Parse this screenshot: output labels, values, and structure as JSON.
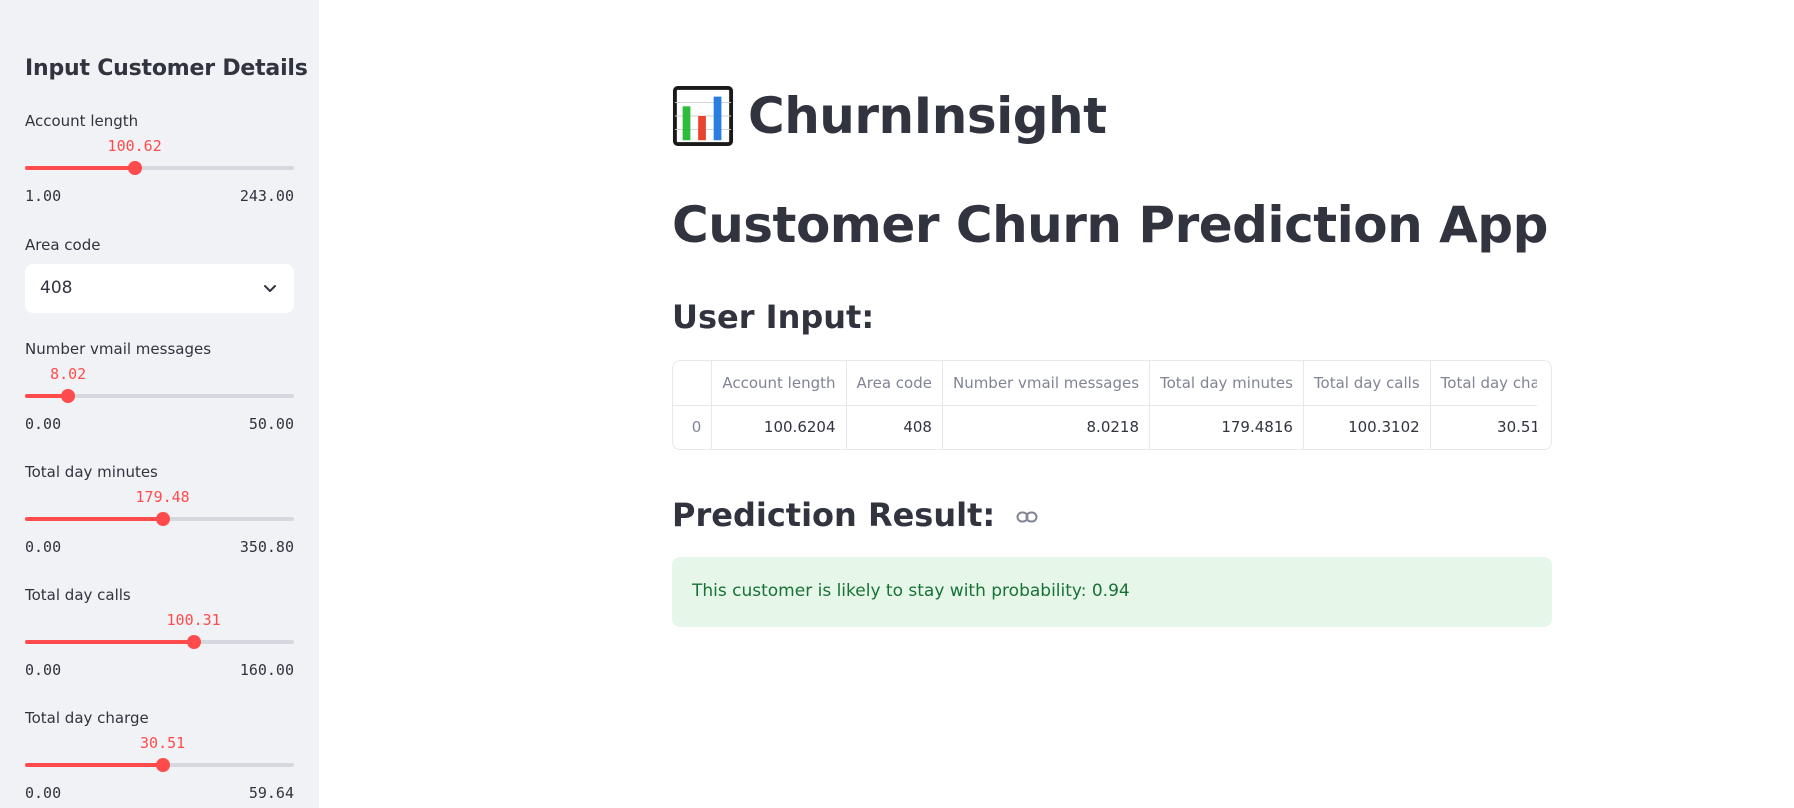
{
  "sidebar": {
    "title": "Input Customer Details",
    "sliders": [
      {
        "label": "Account length",
        "value": "100.62",
        "min": "1.00",
        "max": "243.00",
        "fraction": 0.4076
      },
      {
        "label": "Number vmail messages",
        "value": "8.02",
        "min": "0.00",
        "max": "50.00",
        "fraction": 0.1604
      },
      {
        "label": "Total day minutes",
        "value": "179.48",
        "min": "0.00",
        "max": "350.80",
        "fraction": 0.5116
      },
      {
        "label": "Total day calls",
        "value": "100.31",
        "min": "0.00",
        "max": "160.00",
        "fraction": 0.6269
      },
      {
        "label": "Total day charge",
        "value": "30.51",
        "min": "0.00",
        "max": "59.64",
        "fraction": 0.5116
      }
    ],
    "area_code": {
      "label": "Area code",
      "value": "408"
    }
  },
  "main": {
    "brand_title": "ChurnInsight",
    "brand_icon": "bar-chart-icon",
    "app_title": "Customer Churn Prediction App",
    "user_input_heading": "User Input:",
    "table": {
      "columns": [
        "",
        "Account length",
        "Area code",
        "Number vmail messages",
        "Total day minutes",
        "Total day calls",
        "Total day cha"
      ],
      "rows": [
        [
          "0",
          "100.6204",
          "408",
          "8.0218",
          "179.4816",
          "100.3102",
          "30.51"
        ]
      ]
    },
    "prediction_heading": "Prediction Result:",
    "prediction_text": "This customer is likely to stay with probability: 0.94"
  },
  "colors": {
    "accent": "#ff4b4b",
    "sidebar_bg": "#f0f2f6",
    "success_bg": "#e6f7ea",
    "success_text": "#177233"
  }
}
